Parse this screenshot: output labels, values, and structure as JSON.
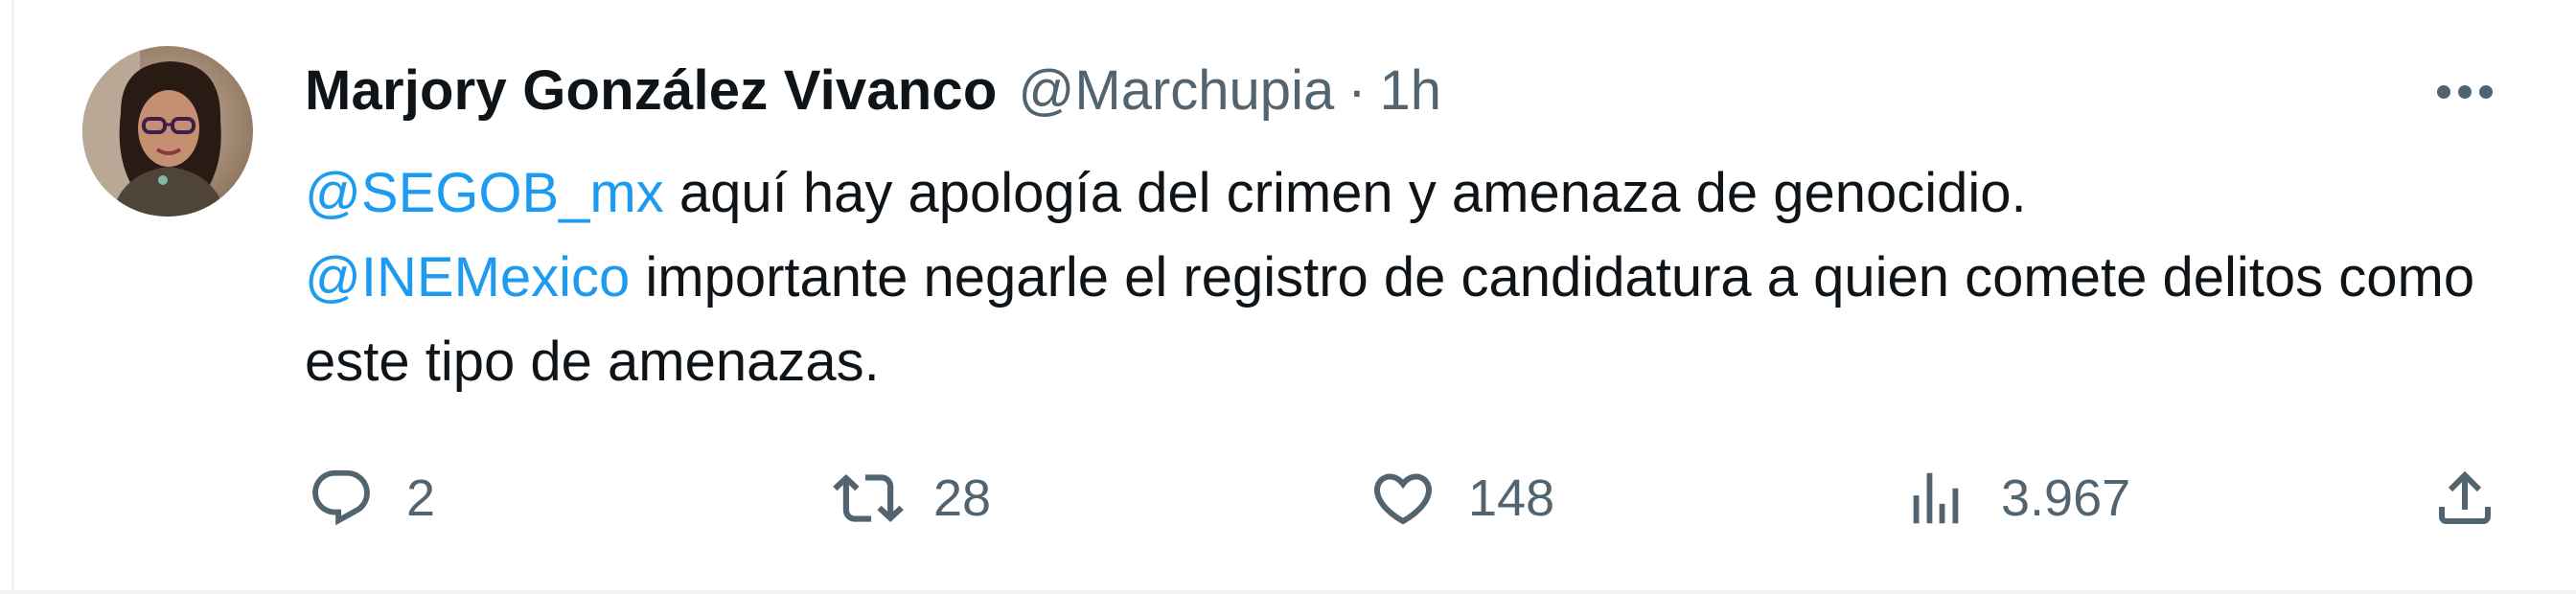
{
  "tweet": {
    "author": {
      "display_name": "Marjory González Vivanco",
      "handle": "@Marchupia",
      "separator": "·",
      "time": "1h"
    },
    "body": {
      "line1_mention": "@SEGOB_mx",
      "line1_text": " aquí hay apología del crimen y amenaza de genocidio.",
      "line2_mention": "@INEMexico",
      "line2_text": " importante negarle el registro de candidatura a quien comete delitos como este tipo de amenazas."
    },
    "metrics": {
      "replies": "2",
      "retweets": "28",
      "likes": "148",
      "views": "3.967"
    },
    "icons": {
      "more": "more-horizontal-icon",
      "reply": "reply-icon",
      "retweet": "retweet-icon",
      "like": "heart-icon",
      "views": "views-analytics-icon",
      "share": "share-icon"
    },
    "colors": {
      "text": "#0f1419",
      "secondary": "#536471",
      "link": "#1d9bf0"
    }
  }
}
